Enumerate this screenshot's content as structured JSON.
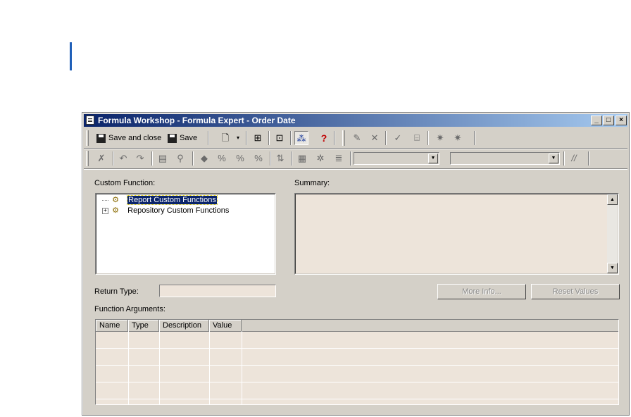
{
  "window": {
    "title": "Formula Workshop - Formula Expert - Order Date",
    "controls": [
      "_",
      "□",
      "×"
    ]
  },
  "toolbar1": {
    "save_and_close_label": "Save and close",
    "save_label": "Save",
    "icons": [
      "new-icon",
      "dropdown-arrow-icon",
      "tree-toggle-icon",
      "properties-icon",
      "wand-icon",
      "help-icon",
      "browse-icon",
      "delete-icon",
      "check-icon",
      "expert-icon",
      "custom-function-icon",
      "use-extractor-icon"
    ],
    "help_glyph": "?"
  },
  "toolbar2": {
    "comment_glyph": "//",
    "combo1_value": "",
    "combo2_value": ""
  },
  "custom_function": {
    "label": "Custom Function:",
    "items": [
      {
        "label": "Report Custom Functions",
        "selected": true
      },
      {
        "label": "Repository Custom Functions",
        "selected": false
      }
    ]
  },
  "summary": {
    "label": "Summary:",
    "value": ""
  },
  "return_type": {
    "label": "Return Type:",
    "value": ""
  },
  "buttons": {
    "more_info": "More Info...",
    "reset_values": "Reset Values"
  },
  "function_arguments": {
    "label": "Function Arguments:",
    "columns": [
      "Name",
      "Type",
      "Description",
      "Value"
    ],
    "rows": []
  }
}
